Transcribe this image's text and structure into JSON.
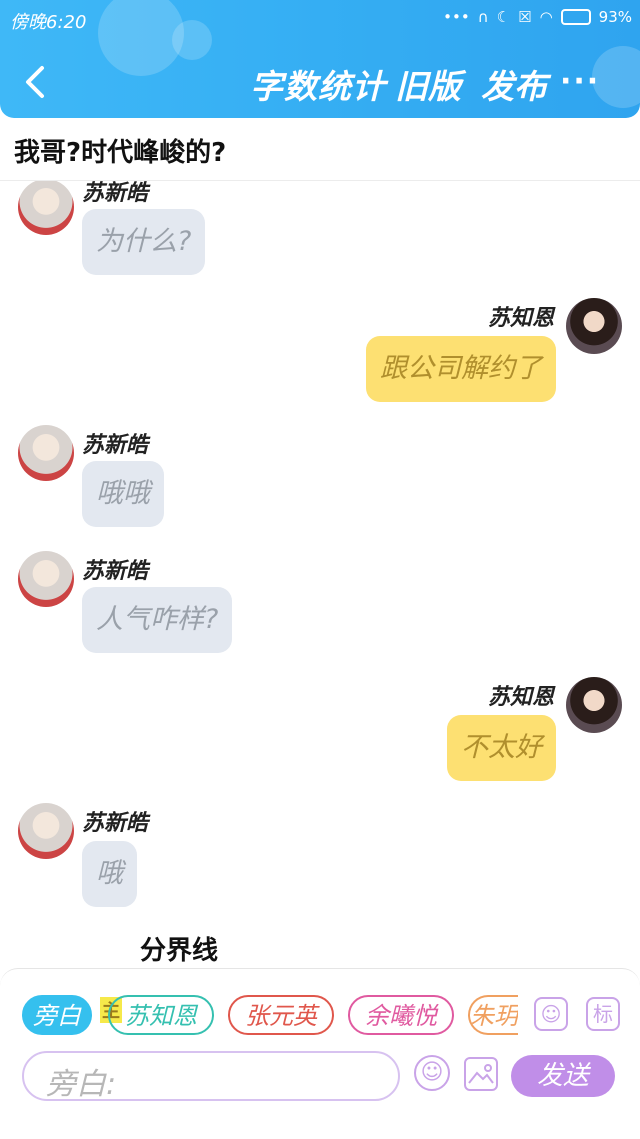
{
  "status": {
    "time": "傍晚6:20",
    "battery": "93%"
  },
  "nav": {
    "title": "字数统计",
    "actions": [
      "旧版",
      "发布"
    ],
    "more": "···"
  },
  "story_title": "我哥?时代峰峻的?",
  "messages": [
    {
      "side": "left",
      "name": "苏新皓",
      "text": "为什么?"
    },
    {
      "side": "right",
      "name": "苏知恩",
      "text": "跟公司解约了"
    },
    {
      "side": "left",
      "name": "苏新皓",
      "text": "哦哦"
    },
    {
      "side": "left",
      "name": "苏新皓",
      "text": "人气咋样?"
    },
    {
      "side": "right",
      "name": "苏知恩",
      "text": "不太好"
    },
    {
      "side": "left",
      "name": "苏新皓",
      "text": "哦"
    }
  ],
  "divider": "分界线",
  "roles": {
    "narrator": "旁白",
    "main_tag": "主",
    "chips": [
      {
        "label": "苏知恩",
        "color": "#35c0b0"
      },
      {
        "label": "张元英",
        "color": "#e0574c"
      },
      {
        "label": "余曦悦",
        "color": "#e05aa0"
      },
      {
        "label": "朱玥",
        "color": "#f0a060"
      }
    ],
    "contact_icon": "contact-icon",
    "tag_label": "标"
  },
  "composer": {
    "placeholder": "旁白:",
    "send": "发送"
  }
}
